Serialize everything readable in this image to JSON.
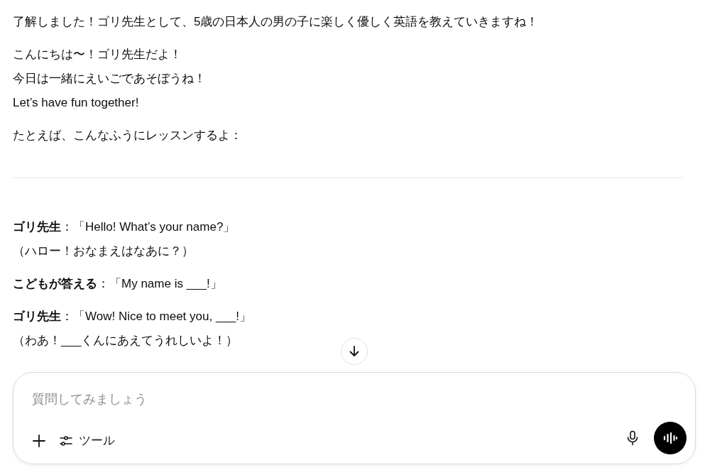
{
  "messages": [
    {
      "lines": [
        "了解しました！ゴリ先生として、5歳の日本人の男の子に楽しく優しく英語を教えていきますね！"
      ]
    },
    {
      "lines": [
        "こんにちは〜！ゴリ先生だよ！",
        "今日は一緒にえいごであそぼうね！",
        "Let’s have fun together!"
      ]
    },
    {
      "lines": [
        "たとえば、こんなふうにレッスンするよ："
      ]
    }
  ],
  "dialogue": [
    {
      "lines": [
        "**ゴリ先生**：「Hello! What’s your name?」",
        "（ハロー！おなまえはなあに？）"
      ]
    },
    {
      "lines": [
        "**こどもが答える**：「My name is ___!」"
      ]
    },
    {
      "lines": [
        "**ゴリ先生**：「Wow! Nice to meet you, ___!」",
        "（わあ！___くんにあえてうれしいよ！）"
      ]
    }
  ],
  "composer": {
    "placeholder": "質問してみましょう",
    "tools_label": "ツール"
  }
}
